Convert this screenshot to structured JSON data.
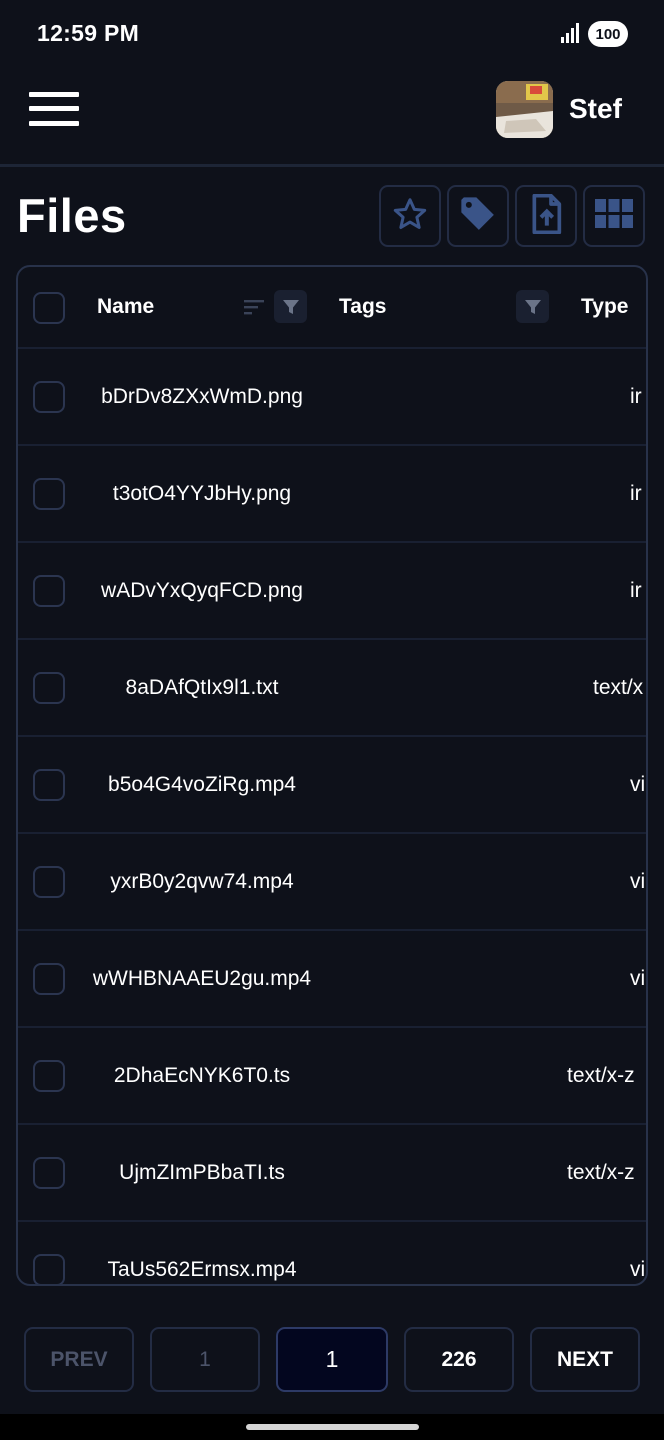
{
  "status_bar": {
    "time": "12:59 PM",
    "battery": "100"
  },
  "header": {
    "username": "Stef"
  },
  "page": {
    "title": "Files"
  },
  "toolbar": {
    "favorites_icon": "star-icon",
    "tags_icon": "tag-icon",
    "upload_icon": "file-upload-icon",
    "view_icon": "grid-view-icon"
  },
  "table": {
    "columns": {
      "name": "Name",
      "tags": "Tags",
      "type": "Type"
    },
    "rows": [
      {
        "name": "bDrDv8ZXxWmD.png",
        "tags": "",
        "type": "ir"
      },
      {
        "name": "t3otO4YYJbHy.png",
        "tags": "",
        "type": "ir"
      },
      {
        "name": "wADvYxQyqFCD.png",
        "tags": "",
        "type": "ir"
      },
      {
        "name": "8aDAfQtIx9l1.txt",
        "tags": "",
        "type": "text/x"
      },
      {
        "name": "b5o4G4voZiRg.mp4",
        "tags": "",
        "type": "vi"
      },
      {
        "name": "yxrB0y2qvw74.mp4",
        "tags": "",
        "type": "vi"
      },
      {
        "name": "wWHBNAAEU2gu.mp4",
        "tags": "",
        "type": "vi"
      },
      {
        "name": "2DhaEcNYK6T0.ts",
        "tags": "",
        "type": "text/x-z"
      },
      {
        "name": "UjmZImPBbaTI.ts",
        "tags": "",
        "type": "text/x-z"
      },
      {
        "name": "TaUs562Ermsx.mp4",
        "tags": "",
        "type": "vi"
      }
    ]
  },
  "pagination": {
    "prev": "PREV",
    "first": "1",
    "current": "1",
    "last": "226",
    "next": "NEXT"
  },
  "colors": {
    "background": "#0e111a",
    "border": "#232c44",
    "accent_icon": "#3a5488",
    "current_page_bg": "#03061f"
  }
}
